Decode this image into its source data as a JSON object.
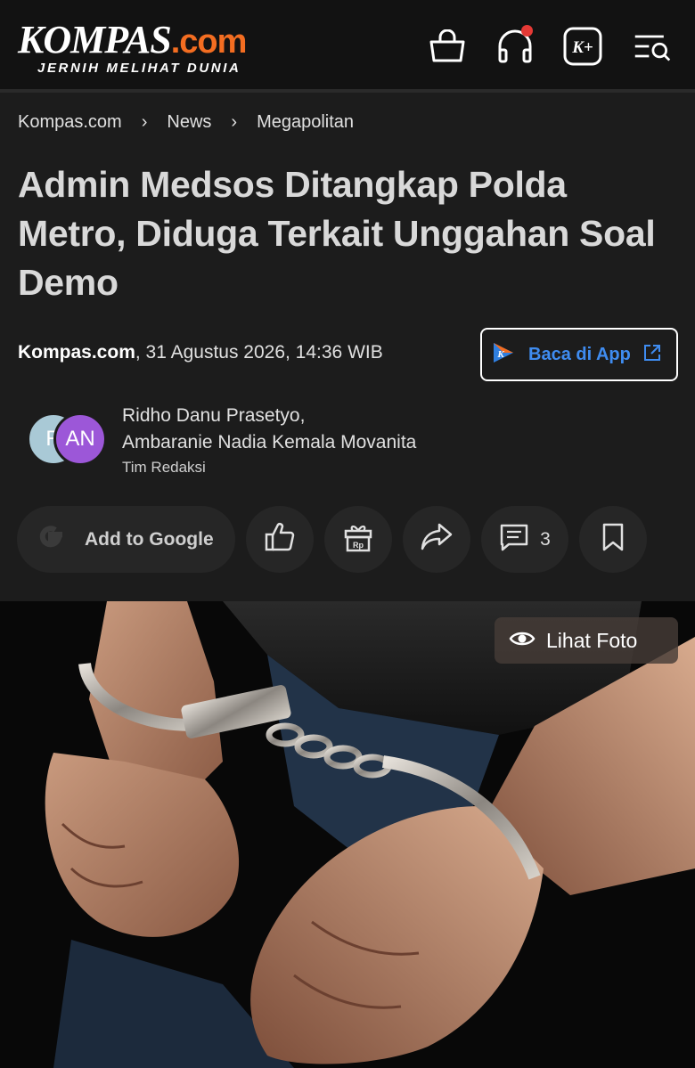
{
  "header": {
    "logo_main": "KOMPAS",
    "logo_suffix": ".com",
    "logo_tagline": "JERNIH MELIHAT DUNIA",
    "icons": [
      "shopping-bag-icon",
      "headphones-icon",
      "kompas-plus-icon",
      "menu-search-icon"
    ],
    "kplus_label": "K+"
  },
  "breadcrumb": [
    "Kompas.com",
    "News",
    "Megapolitan"
  ],
  "breadcrumb_separator": "›",
  "article": {
    "title": "Admin Medsos Ditangkap Polda Metro, Diduga Terkait Unggahan Soal Demo",
    "source": "Kompas.com",
    "datetime": ", 31 Agustus 2026, 14:36 WIB",
    "app_button": "Baca di App",
    "authors_line1": "Ridho Danu Prasetyo,",
    "authors_line2": "Ambaranie Nadia Kemala Movanita",
    "team": "Tim Redaksi",
    "avatar_1": "R",
    "avatar_2": "AN"
  },
  "actions": {
    "google_label": "Add to Google",
    "comment_count": "3"
  },
  "photo": {
    "view_label": "Lihat Foto"
  },
  "colors": {
    "accent_orange": "#f36d21",
    "link_blue": "#3f8cf0",
    "notification_red": "#e53935"
  }
}
